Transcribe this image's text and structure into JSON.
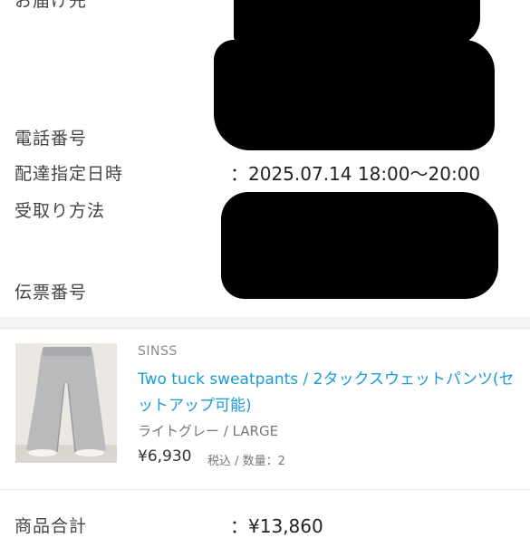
{
  "delivery": {
    "address_label": "お届け先",
    "phone_label": "電話番号",
    "date_label": "配達指定日時",
    "date_value": "：2025.07.14 18:00〜20:00",
    "method_label": "受取り方法",
    "slip_label": "伝票番号"
  },
  "product": {
    "brand": "SINSS",
    "name": "Two tuck sweatpants / 2タックスウェットパンツ(セットアップ可能)",
    "variant": "ライトグレー / LARGE",
    "price": "¥6,930",
    "tax_qty": "税込 / 数量：2"
  },
  "totals": {
    "subtotal_label": "商品合計",
    "subtotal_value": "：¥13,860"
  }
}
